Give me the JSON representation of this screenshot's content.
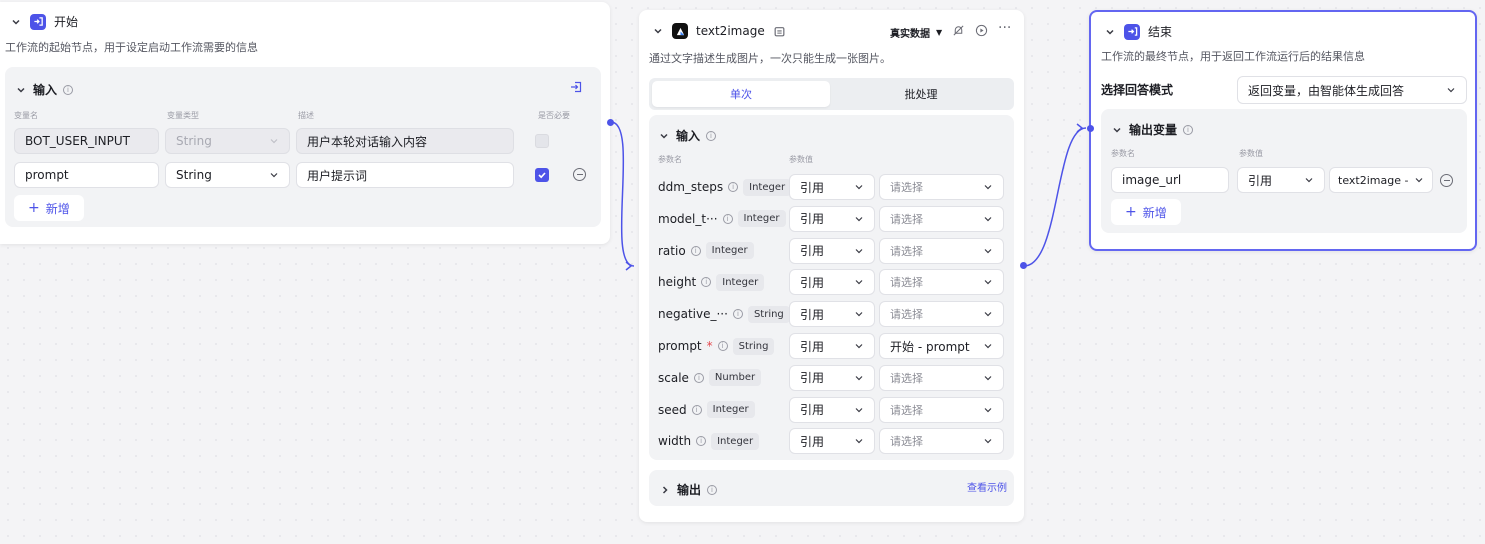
{
  "start": {
    "title": "开始",
    "description": "工作流的起始节点，用于设定启动工作流需要的信息",
    "input_section": "输入",
    "columns": [
      "变量名",
      "变量类型",
      "描述",
      "是否必要"
    ],
    "rows": [
      {
        "name": "BOT_USER_INPUT",
        "type": "String",
        "description": "用户本轮对话输入内容",
        "required": false
      },
      {
        "name": "prompt",
        "type": "String",
        "description": "用户提示词",
        "required": true
      }
    ],
    "add_label": "新增"
  },
  "t2i": {
    "title": "text2image",
    "mode": "真实数据",
    "description": "通过文字描述生成图片，一次只能生成一张图片。",
    "tabs": [
      "单次",
      "批处理"
    ],
    "input_section": "输入",
    "columns": [
      "参数名",
      "参数值"
    ],
    "params": [
      {
        "name": "ddm_steps",
        "type": "Integer",
        "required": false,
        "ref": "引用",
        "value": "请选择"
      },
      {
        "name": "model_t···",
        "type": "Integer",
        "required": false,
        "ref": "引用",
        "value": "请选择"
      },
      {
        "name": "ratio",
        "type": "Integer",
        "required": false,
        "ref": "引用",
        "value": "请选择"
      },
      {
        "name": "height",
        "type": "Integer",
        "required": false,
        "ref": "引用",
        "value": "请选择"
      },
      {
        "name": "negative_···",
        "type": "String",
        "required": false,
        "ref": "引用",
        "value": "请选择"
      },
      {
        "name": "prompt",
        "type": "String",
        "required": true,
        "ref": "引用",
        "value": "开始 - prompt"
      },
      {
        "name": "scale",
        "type": "Number",
        "required": false,
        "ref": "引用",
        "value": "请选择"
      },
      {
        "name": "seed",
        "type": "Integer",
        "required": false,
        "ref": "引用",
        "value": "请选择"
      },
      {
        "name": "width",
        "type": "Integer",
        "required": false,
        "ref": "引用",
        "value": "请选择"
      }
    ],
    "output_section": "输出",
    "view_example": "查看示例"
  },
  "end": {
    "title": "结束",
    "description": "工作流的最终节点，用于返回工作流运行后的结果信息",
    "answer_mode_label": "选择回答模式",
    "answer_mode_value": "返回变量，由智能体生成回答",
    "output_section": "输出变量",
    "columns": [
      "参数名",
      "参数值"
    ],
    "rows": [
      {
        "name": "image_url",
        "ref": "引用",
        "value": "text2image -"
      }
    ],
    "add_label": "新增"
  },
  "colors": {
    "accent": "#4d53e8",
    "start_icon": "#4d53e8",
    "end_icon": "#4d53e8"
  }
}
